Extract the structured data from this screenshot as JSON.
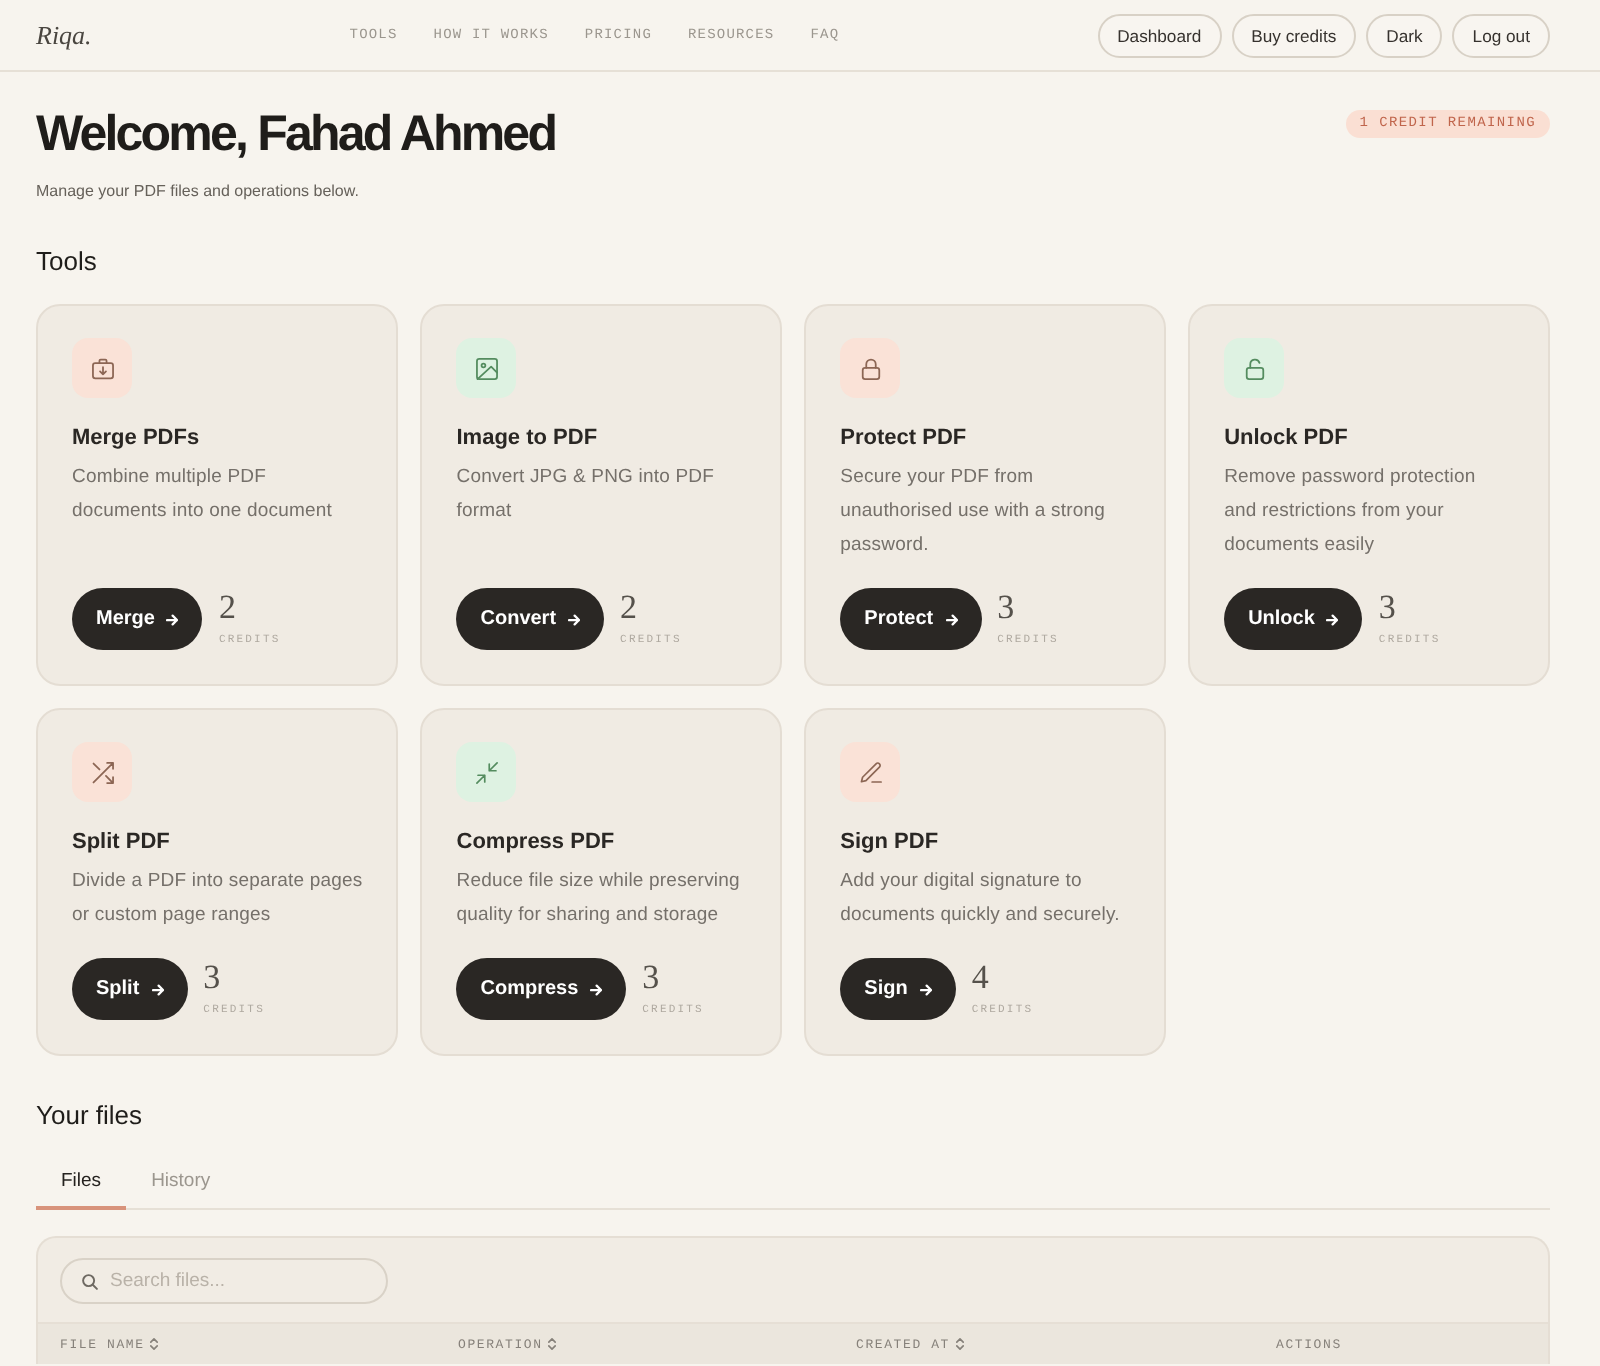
{
  "header": {
    "logo": "Riqa.",
    "nav": [
      {
        "label": "TOOLS"
      },
      {
        "label": "HOW IT WORKS"
      },
      {
        "label": "PRICING"
      },
      {
        "label": "RESOURCES"
      },
      {
        "label": "FAQ"
      }
    ],
    "buttons": [
      {
        "label": "Dashboard"
      },
      {
        "label": "Buy credits"
      },
      {
        "label": "Dark"
      },
      {
        "label": "Log out"
      }
    ]
  },
  "welcome": {
    "title": "Welcome, Fahad Ahmed",
    "subtitle": "Manage your PDF files and operations below.",
    "credit_badge": "1 CREDIT REMAINING"
  },
  "tools": {
    "heading": "Tools",
    "cards": [
      {
        "kind": "merge",
        "color": "#fae2d7",
        "title": "Merge PDFs",
        "description": [
          "Combine multiple PDF",
          "documents into one document"
        ],
        "action": "Merge",
        "cost": "2",
        "cost_label": "CREDITS"
      },
      {
        "kind": "image",
        "color": "#def2e2",
        "title": "Image to PDF",
        "description": [
          "Convert JPG & PNG into PDF",
          "format"
        ],
        "action": "Convert",
        "cost": "2",
        "cost_label": "CREDITS"
      },
      {
        "kind": "protect",
        "color": "#fae2d7",
        "title": "Protect PDF",
        "description": [
          "Secure your PDF from",
          "unauthorised use with a strong",
          "password."
        ],
        "action": "Protect",
        "cost": "3",
        "cost_label": "CREDITS"
      },
      {
        "kind": "unlock",
        "color": "#def2e2",
        "title": "Unlock PDF",
        "description": [
          "Remove password protection",
          "and restrictions from your",
          "documents easily"
        ],
        "action": "Unlock",
        "cost": "3",
        "cost_label": "CREDITS"
      },
      {
        "kind": "split",
        "color": "#fae2d7",
        "title": "Split PDF",
        "description": [
          "Divide a PDF into separate pages",
          "or custom page ranges"
        ],
        "action": "Split",
        "cost": "3",
        "cost_label": "CREDITS"
      },
      {
        "kind": "compress",
        "color": "#def2e2",
        "title": "Compress PDF",
        "description": [
          "Reduce file size while preserving",
          "quality for sharing and storage"
        ],
        "action": "Compress",
        "cost": "3",
        "cost_label": "CREDITS"
      },
      {
        "kind": "sign",
        "color": "#fae2d7",
        "title": "Sign PDF",
        "description": [
          "Add your digital signature to",
          "documents quickly and securely."
        ],
        "action": "Sign",
        "cost": "4",
        "cost_label": "CREDITS"
      }
    ]
  },
  "files": {
    "heading": "Your files",
    "tabs": [
      {
        "label": "Files",
        "selected": true
      },
      {
        "label": "History",
        "selected": false
      }
    ],
    "search": {
      "placeholder": "Search files..."
    },
    "table": {
      "columns": [
        {
          "label": "FILE NAME",
          "sortable": true
        },
        {
          "label": "OPERATION",
          "sortable": true
        },
        {
          "label": "CREATED AT",
          "sortable": true
        },
        {
          "label": "ACTIONS",
          "sortable": false
        }
      ]
    }
  }
}
